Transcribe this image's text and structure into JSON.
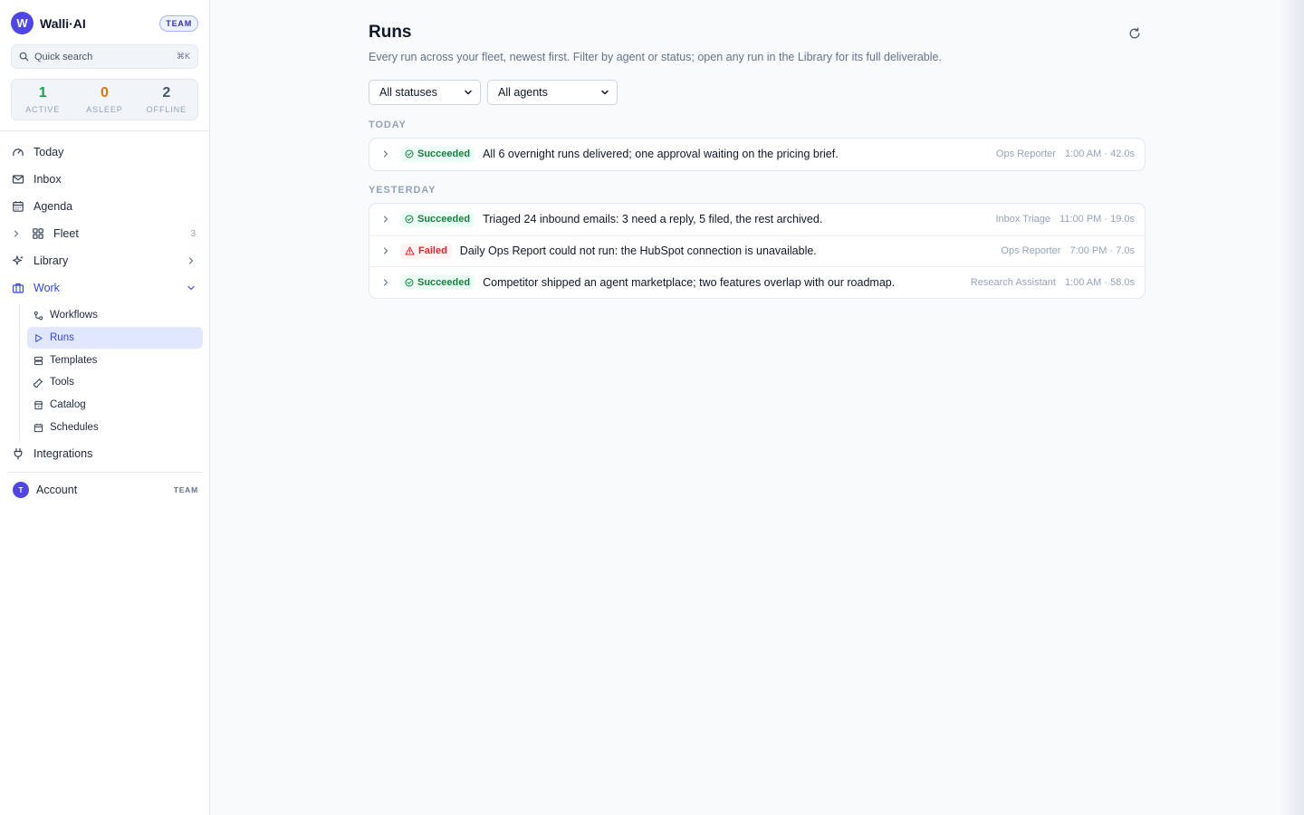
{
  "brand": {
    "logo_letter": "W",
    "name": "Walli·AI",
    "badge": "TEAM"
  },
  "search": {
    "placeholder": "Quick search",
    "shortcut": "⌘K"
  },
  "stats": [
    {
      "value": "1",
      "label": "ACTIVE",
      "color": "#16a34a"
    },
    {
      "value": "0",
      "label": "ASLEEP",
      "color": "#d97706"
    },
    {
      "value": "2",
      "label": "OFFLINE",
      "color": "#475569"
    }
  ],
  "nav": {
    "today": "Today",
    "inbox": "Inbox",
    "agenda": "Agenda",
    "fleet": "Fleet",
    "fleet_count": "3",
    "library": "Library",
    "work": "Work",
    "integrations": "Integrations"
  },
  "work_sub": {
    "workflows": "Workflows",
    "runs": "Runs",
    "templates": "Templates",
    "tools": "Tools",
    "catalog": "Catalog",
    "schedules": "Schedules"
  },
  "account": {
    "avatar_letter": "T",
    "name": "Account",
    "badge": "TEAM"
  },
  "page": {
    "title": "Runs",
    "subtitle": "Every run across your fleet, newest first. Filter by agent or status; open any run in the Library for its full deliverable."
  },
  "filters": {
    "status": {
      "selected": "All statuses"
    },
    "agent": {
      "selected": "All agents"
    }
  },
  "groups": {
    "today": {
      "label": "TODAY",
      "runs": [
        {
          "status": "Succeeded",
          "summary": "All 6 overnight runs delivered; one approval waiting on the pricing brief.",
          "agent": "Ops Reporter",
          "time": "1:00 AM · 42.0s"
        }
      ]
    },
    "yesterday": {
      "label": "YESTERDAY",
      "runs": [
        {
          "status": "Succeeded",
          "summary": "Triaged 24 inbound emails: 3 need a reply, 5 filed, the rest archived.",
          "agent": "Inbox Triage",
          "time": "11:00 PM · 19.0s"
        },
        {
          "status": "Failed",
          "summary": "Daily Ops Report could not run: the HubSpot connection is unavailable.",
          "agent": "Ops Reporter",
          "time": "7:00 PM · 7.0s"
        },
        {
          "status": "Succeeded",
          "summary": "Competitor shipped an agent marketplace; two features overlap with our roadmap.",
          "agent": "Research Assistant",
          "time": "1:00 AM · 58.0s"
        }
      ]
    }
  },
  "colors": {
    "accent": "#3749d8",
    "success": "#15803d",
    "danger": "#dc2626"
  }
}
